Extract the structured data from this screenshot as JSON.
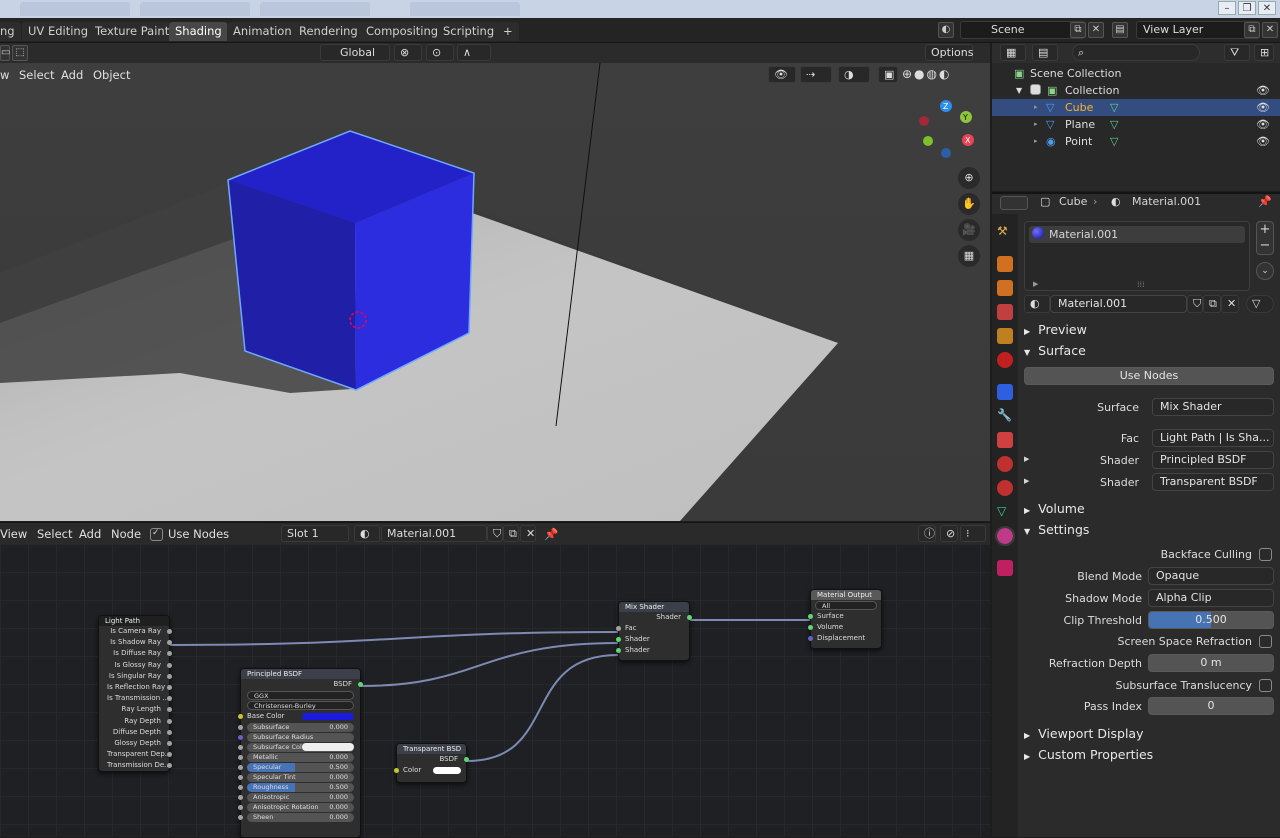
{
  "workspaces": [
    "ng",
    "UV Editing",
    "Texture Paint",
    "Shading",
    "Animation",
    "Rendering",
    "Compositing",
    "Scripting",
    "+"
  ],
  "active_workspace": "Shading",
  "scene": {
    "label": "Scene"
  },
  "view_layer": {
    "label": "View Layer"
  },
  "viewport": {
    "menus": [
      "w",
      "Select",
      "Add",
      "Object"
    ],
    "transform": "Global",
    "options": "Options"
  },
  "outliner": {
    "root": "Scene Collection",
    "collection": "Collection",
    "items": [
      "Cube",
      "Plane",
      "Point"
    ]
  },
  "properties": {
    "breadcrumb_object": "Cube",
    "breadcrumb_material": "Material.001",
    "slot_item": "Material.001",
    "material_name": "Material.001",
    "preview": "Preview",
    "surface_section": "Surface",
    "use_nodes": "Use Nodes",
    "surface_label": "Surface",
    "surface_value": "Mix Shader",
    "fac_label": "Fac",
    "fac_value": "Light Path | Is Sha...",
    "shader1_label": "Shader",
    "shader1_value": "Principled BSDF",
    "shader2_label": "Shader",
    "shader2_value": "Transparent BSDF",
    "volume": "Volume",
    "settings": "Settings",
    "backface_culling": "Backface Culling",
    "blend_mode_label": "Blend Mode",
    "blend_mode": "Opaque",
    "shadow_mode_label": "Shadow Mode",
    "shadow_mode": "Alpha Clip",
    "clip_threshold_label": "Clip Threshold",
    "clip_threshold": "0.500",
    "ssr": "Screen Space Refraction",
    "refraction_depth_label": "Refraction Depth",
    "refraction_depth": "0 m",
    "sss_translucency": "Subsurface Translucency",
    "pass_index_label": "Pass Index",
    "pass_index": "0",
    "viewport_display": "Viewport Display",
    "custom_properties": "Custom Properties"
  },
  "node_editor": {
    "menus": [
      "View",
      "Select",
      "Add",
      "Node"
    ],
    "use_nodes": "Use Nodes",
    "slot": "Slot 1",
    "material": "Material.001"
  },
  "nodes": {
    "light_path": {
      "title": "Light Path",
      "outputs": [
        "Is Camera Ray",
        "Is Shadow Ray",
        "Is Diffuse Ray",
        "Is Glossy Ray",
        "Is Singular Ray",
        "Is Reflection Ray",
        "Is Transmission ...",
        "Ray Length",
        "Ray Depth",
        "Diffuse Depth",
        "Glossy Depth",
        "Transparent Dep...",
        "Transmission De..."
      ]
    },
    "principled": {
      "title": "Principled BSDF",
      "output": "BSDF",
      "dist": "GGX",
      "sss": "Christensen-Burley",
      "base_color": "Base Color",
      "params": [
        [
          "Subsurface",
          "0.000"
        ],
        [
          "Subsurface Radius",
          ""
        ],
        [
          "Subsurface Colo",
          ""
        ],
        [
          "Metallic",
          "0.000"
        ],
        [
          "Specular",
          "0.500"
        ],
        [
          "Specular Tint",
          "0.000"
        ],
        [
          "Roughness",
          "0.500"
        ],
        [
          "Anisotropic",
          "0.000"
        ],
        [
          "Anisotropic Rotation",
          "0.000"
        ],
        [
          "Sheen",
          "0.000"
        ]
      ]
    },
    "transparent": {
      "title": "Transparent BSD",
      "output": "BSDF",
      "color": "Color"
    },
    "mix": {
      "title": "Mix Shader",
      "output": "Shader",
      "inputs": [
        "Fac",
        "Shader",
        "Shader"
      ]
    },
    "output": {
      "title": "Material Output",
      "target": "All",
      "inputs": [
        "Surface",
        "Volume",
        "Displacement"
      ]
    }
  },
  "colors": {
    "accent": "#4772b3",
    "cube": "#2a2ad0",
    "base_color": "#1a1ae0"
  }
}
